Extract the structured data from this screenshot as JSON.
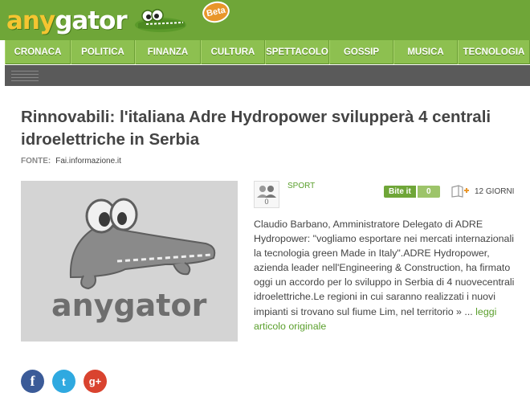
{
  "header": {
    "logo_text_part1": "any",
    "logo_text_part2": "gator",
    "beta_label": "Beta"
  },
  "nav": {
    "items": [
      "CRONACA",
      "POLITICA",
      "FINANZA",
      "CULTURA",
      "SPETTACOLO",
      "GOSSIP",
      "MUSICA",
      "TECNOLOGIA"
    ]
  },
  "article": {
    "title": "Rinnovabili: l'italiana Adre Hydropower svilupperà 4 centrali idroelettriche in Serbia",
    "source_label": "FONTE:",
    "source_value": "Fai.informazione.it",
    "thumbnail_logo_text": "anygator",
    "user_count": "0",
    "category": "SPORT",
    "bite_label": "Bite it",
    "bite_count": "0",
    "age": "12 GIORNI",
    "body": "Claudio Barbano, Amministratore Delegato di ADRE Hydropower: \"vogliamo esportare nei mercati internazionali la tecnologia green Made in Italy\".ADRE Hydropower, azienda leader nell'Engineering & Construction, ha firmato oggi un accordo per lo sviluppo in Serbia di 4 nuovecentrali idroelettriche.Le regioni in cui saranno realizzati i nuovi impianti si trovano sul fiume Lim, nel territorio",
    "ellipsis": "» ...",
    "read_more": "leggi articolo originale"
  },
  "social": {
    "facebook_glyph": "f",
    "twitter_glyph": "t",
    "gplus_glyph": "g+"
  },
  "colors": {
    "header_green": "#6fa638",
    "nav_green": "#8dc050",
    "dark_bar": "#5a5a5a",
    "link_green": "#5a9f2c"
  }
}
